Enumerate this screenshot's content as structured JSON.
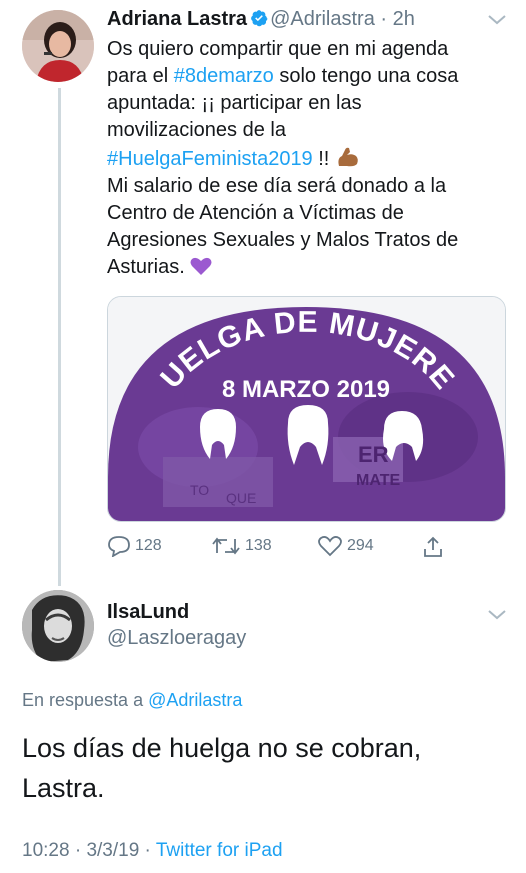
{
  "tweet": {
    "author_name": "Adriana Lastra",
    "author_handle": "@Adrilastra",
    "separator": " · ",
    "time_ago": "2h",
    "text": {
      "line1": "Os quiero compartir que en mi agenda",
      "line2_pre": "para el ",
      "hashtag1": "#8demarzo",
      "line2_post": " solo tengo una cosa",
      "line3": "apuntada: ¡¡ participar en las",
      "line4": "movilizaciones de la",
      "hashtag2": "#HuelgaFeminista2019",
      "line5_post": " !! ",
      "line6": "Mi salario de ese día será donado a la",
      "line7": "Centro de Atención a Víctimas de",
      "line8": "Agresiones Sexuales y Malos Tratos de",
      "line9": "Asturias. "
    },
    "card_image": {
      "arc_text": "HUELGA DE MUJERES",
      "date_text": "8 MARZO 2019",
      "sign1": "ER",
      "sign2": "MATE",
      "sign3": "TO",
      "sign4": "QUE",
      "colors": {
        "purple": "#6a3a93",
        "yellow": "#f0c419"
      }
    },
    "actions": {
      "replies": "128",
      "retweets": "138",
      "likes": "294"
    }
  },
  "reply": {
    "author_name": "IlsaLund",
    "author_handle": "@Laszloeragay",
    "reply_prefix": "En respuesta a ",
    "reply_to": "@Adrilastra",
    "text_line1": "Los días de huelga no se cobran,",
    "text_line2": "Lastra.",
    "time": "10:28",
    "date": "3/3/19",
    "source": "Twitter for iPad",
    "meta_sep": " · "
  },
  "colors": {
    "link": "#1da1f2",
    "muted": "#657786",
    "text": "#14171a"
  },
  "icons": [
    "verified-icon",
    "chevron-down-icon",
    "reply-icon",
    "retweet-icon",
    "like-icon",
    "share-icon",
    "flexed-biceps-emoji",
    "purple-heart-emoji"
  ]
}
